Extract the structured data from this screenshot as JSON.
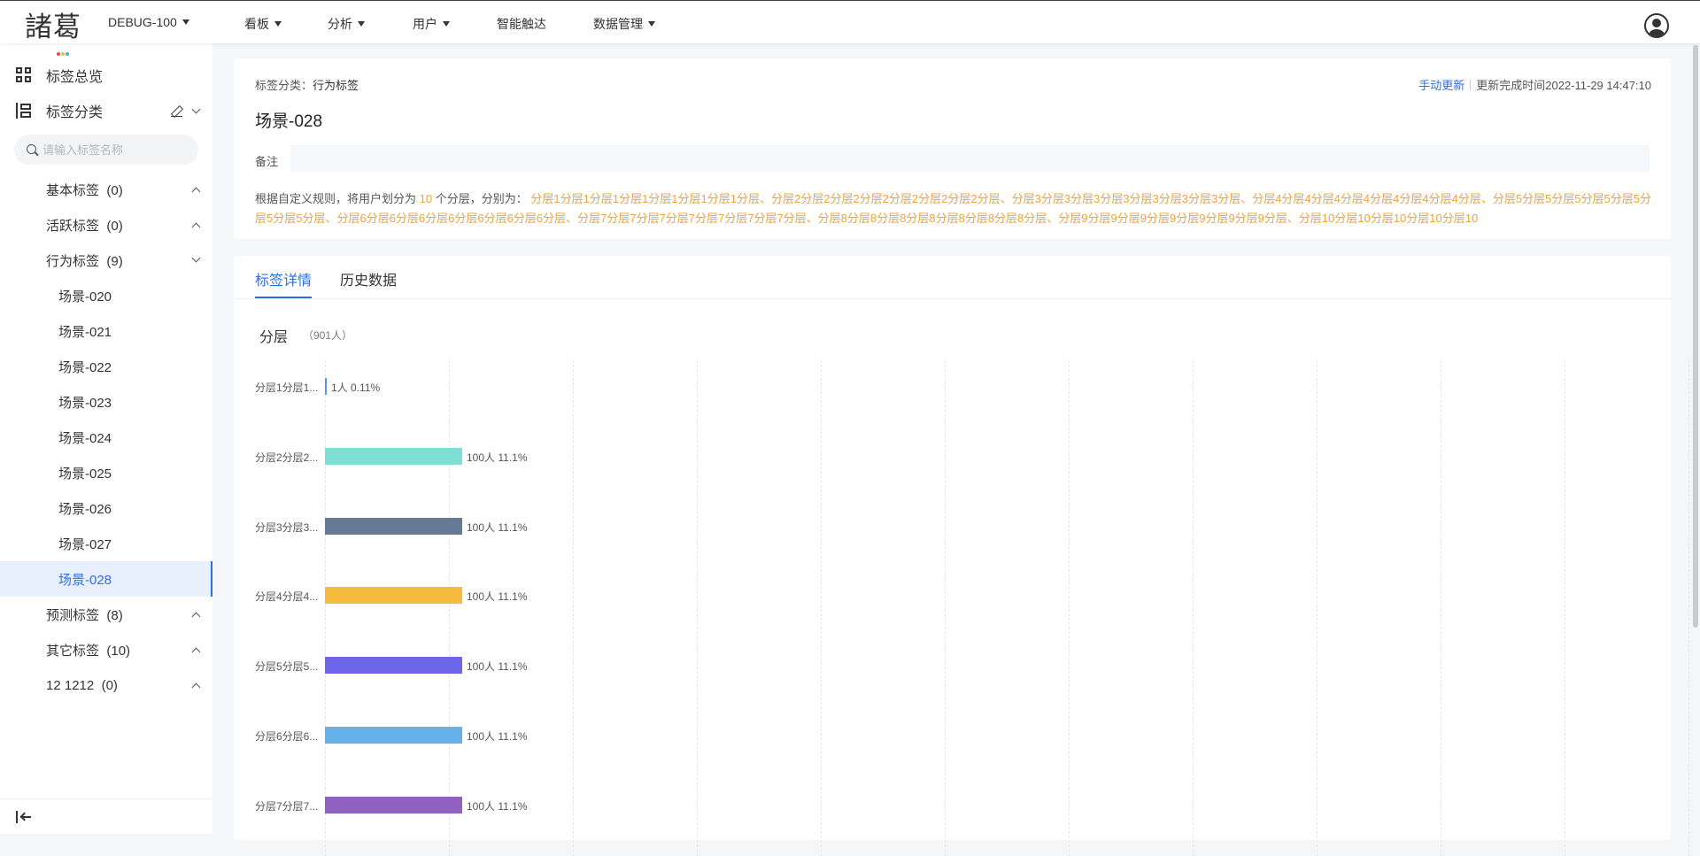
{
  "header": {
    "logo": "諸葛",
    "project": "DEBUG-100",
    "nav": [
      {
        "label": "看板",
        "dropdown": true
      },
      {
        "label": "分析",
        "dropdown": true
      },
      {
        "label": "用户",
        "dropdown": true
      },
      {
        "label": "智能触达",
        "dropdown": false
      },
      {
        "label": "数据管理",
        "dropdown": true
      }
    ]
  },
  "sidebar": {
    "overview": "标签总览",
    "category": "标签分类",
    "search_placeholder": "请输入标签名称",
    "groups": [
      {
        "label": "基本标签",
        "count": "(0)",
        "expanded": false
      },
      {
        "label": "活跃标签",
        "count": "(0)",
        "expanded": false
      },
      {
        "label": "行为标签",
        "count": "(9)",
        "expanded": true
      },
      {
        "label": "预测标签",
        "count": "(8)",
        "expanded": false
      },
      {
        "label": "其它标签",
        "count": "(10)",
        "expanded": false
      },
      {
        "label": "12 1212",
        "count": "(0)",
        "expanded": false
      }
    ],
    "items": [
      "场景-020",
      "场景-021",
      "场景-022",
      "场景-023",
      "场景-024",
      "场景-025",
      "场景-026",
      "场景-027",
      "场景-028"
    ],
    "active_item": "场景-028"
  },
  "detail": {
    "crumb_label": "标签分类：",
    "crumb_value": "行为标签",
    "manual_update": "手动更新",
    "update_time": "更新完成时间2022-11-29 14:47:10",
    "title": "场景-028",
    "remark_label": "备注",
    "remark_value": "",
    "rule_prefix": "根据自定义规则，将用户划分为",
    "rule_count": "10",
    "rule_middle": "个分层，分别为：",
    "rule_layers": "分层1分层1分层1分层1分层1分层1分层1分层、分层2分层2分层2分层2分层2分层2分层2分层、分层3分层3分层3分层3分层3分层3分层3分层、分层4分层4分层4分层4分层4分层4分层4分层、分层5分层5分层5分层5分层5分层5分层5分层、分层6分层6分层6分层6分层6分层6分层6分层、分层7分层7分层7分层7分层7分层7分层7分层、分层8分层8分层8分层8分层8分层8分层8分层、分层9分层9分层9分层9分层9分层9分层9分层、分层10分层10分层10分层10分层10"
  },
  "tabs": [
    {
      "label": "标签详情",
      "active": true
    },
    {
      "label": "历史数据",
      "active": false
    }
  ],
  "section": {
    "title": "分层",
    "count": "（901人）"
  },
  "chart_data": {
    "type": "bar",
    "orientation": "horizontal",
    "categories": [
      "分层1分层1...",
      "分层2分层2...",
      "分层3分层3...",
      "分层4分层4...",
      "分层5分层5...",
      "分层6分层6...",
      "分层7分层7..."
    ],
    "values": [
      1,
      100,
      100,
      100,
      100,
      100,
      100
    ],
    "percents": [
      "0.11%",
      "11.1%",
      "11.1%",
      "11.1%",
      "11.1%",
      "11.1%",
      "11.1%"
    ],
    "value_labels": [
      "1人",
      "100人",
      "100人",
      "100人",
      "100人",
      "100人",
      "100人"
    ],
    "colors": [
      "#5b8ff9",
      "#7fdfd4",
      "#667996",
      "#f5bb3f",
      "#6e66ea",
      "#67b1ea",
      "#9061c0"
    ],
    "xlim": [
      0,
      1000
    ],
    "grid": true
  }
}
